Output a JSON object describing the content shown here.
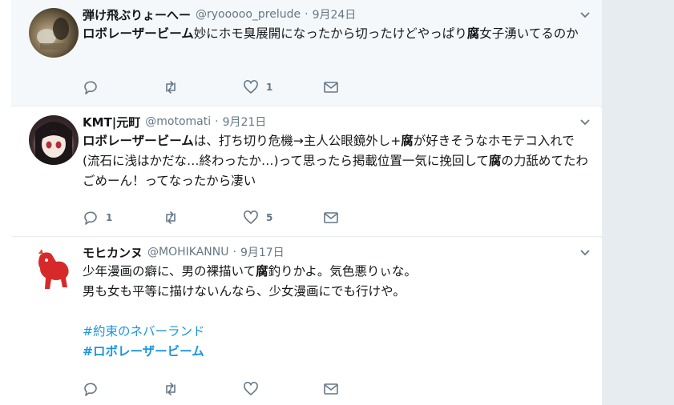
{
  "tweets": [
    {
      "name": "弾け飛ぶりょーへー",
      "handle": "@ryooooo_prelude",
      "date": "9月24日",
      "text_bold_1": "ロボレーザービーム",
      "text_1": "妙にホモ臭展開になったから切ったけどやっぱり",
      "text_bold_2": "腐",
      "text_2": "女子湧いてるのか",
      "reply_count": "",
      "retweet_count": "",
      "like_count": "1"
    },
    {
      "name": "KMT|元町",
      "handle": "@motomati",
      "date": "9月21日",
      "text_bold_1": "ロボレーザービーム",
      "text_1": "は、打ち切り危機→主人公眼鏡外し+",
      "text_bold_2": "腐",
      "text_2": "が好きそうなホモテコ入れで(流石に浅はかだな…終わったか…)って思ったら掲載位置一気に挽回して",
      "text_bold_3": "腐",
      "text_3": "の力舐めてたわごめーん！ってなったから凄い",
      "reply_count": "1",
      "retweet_count": "",
      "like_count": "5"
    },
    {
      "name": "モヒカンヌ",
      "handle": "@MOHIKANNU",
      "date": "9月17日",
      "line1_a": "少年漫画の癖に、男の裸描いて",
      "line1_bold": "腐",
      "line1_b": "釣りかよ。気色悪りぃな。",
      "line2": "男も女も平等に描けないんなら、少女漫画にでも行けや。",
      "hashtag1": "#約束のネバーランド",
      "hashtag2": "#ロボレーザービーム",
      "reply_count": "",
      "retweet_count": "",
      "like_count": ""
    }
  ],
  "icons": {
    "reply": "reply-icon",
    "retweet": "retweet-icon",
    "like": "heart-icon",
    "dm": "envelope-icon",
    "caret": "chevron-down-icon"
  },
  "colors": {
    "secondary_text": "#657786",
    "link": "#1b95e0",
    "highlight_bg": "#f5f8fa",
    "page_bg": "#e6ecf0"
  }
}
